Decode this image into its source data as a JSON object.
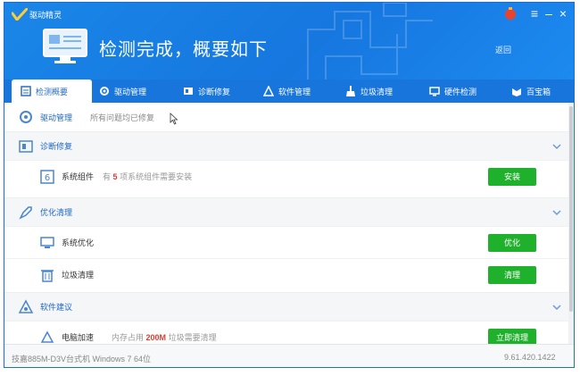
{
  "window": {
    "app_title": "驱动精灵",
    "banner_title": "检测完成，概要如下",
    "back_link": "返回",
    "controls": {
      "menu": "≡",
      "minimize": "–",
      "close": "×"
    }
  },
  "tabs": [
    {
      "label": "检测概要",
      "icon": "report-icon",
      "active": true
    },
    {
      "label": "驱动管理",
      "icon": "gear-icon",
      "active": false
    },
    {
      "label": "诊断修复",
      "icon": "wrench-icon",
      "active": false
    },
    {
      "label": "软件管理",
      "icon": "triangle-icon",
      "active": false
    },
    {
      "label": "垃圾清理",
      "icon": "broom-icon",
      "active": false
    },
    {
      "label": "硬件检测",
      "icon": "monitor-icon",
      "active": false
    },
    {
      "label": "百宝箱",
      "icon": "toolbox-icon",
      "active": false
    }
  ],
  "sections": {
    "driver": {
      "label": "驱动管理",
      "note": "所有问题均已修复"
    },
    "diagnose": {
      "label": "诊断修复"
    },
    "optimize": {
      "label": "优化清理"
    },
    "software": {
      "label": "软件建议"
    }
  },
  "items": {
    "system_component": {
      "label": "系统组件",
      "desc_prefix": "有",
      "count": "5",
      "desc_suffix": "项系统组件需要安装",
      "button": "安装"
    },
    "system_optimize": {
      "label": "系统优化",
      "button": "优化"
    },
    "junk_clean": {
      "label": "垃圾清理",
      "button": "清理"
    },
    "computer_accel": {
      "label": "电脑加速",
      "desc_prefix": "内存占用",
      "amount": "200M",
      "desc_suffix": "垃圾需要清理",
      "button": "立即清理"
    }
  },
  "status": {
    "left": "技嘉885M-D3V台式机   Windows 7 64位",
    "version": "9.61.420.1422"
  },
  "colors": {
    "header_blue": "#1677df",
    "tab_bar": "#1875dc",
    "accent_green": "#1fb02c",
    "highlight_red": "#e23b2e",
    "section_text": "#1f67c2"
  }
}
